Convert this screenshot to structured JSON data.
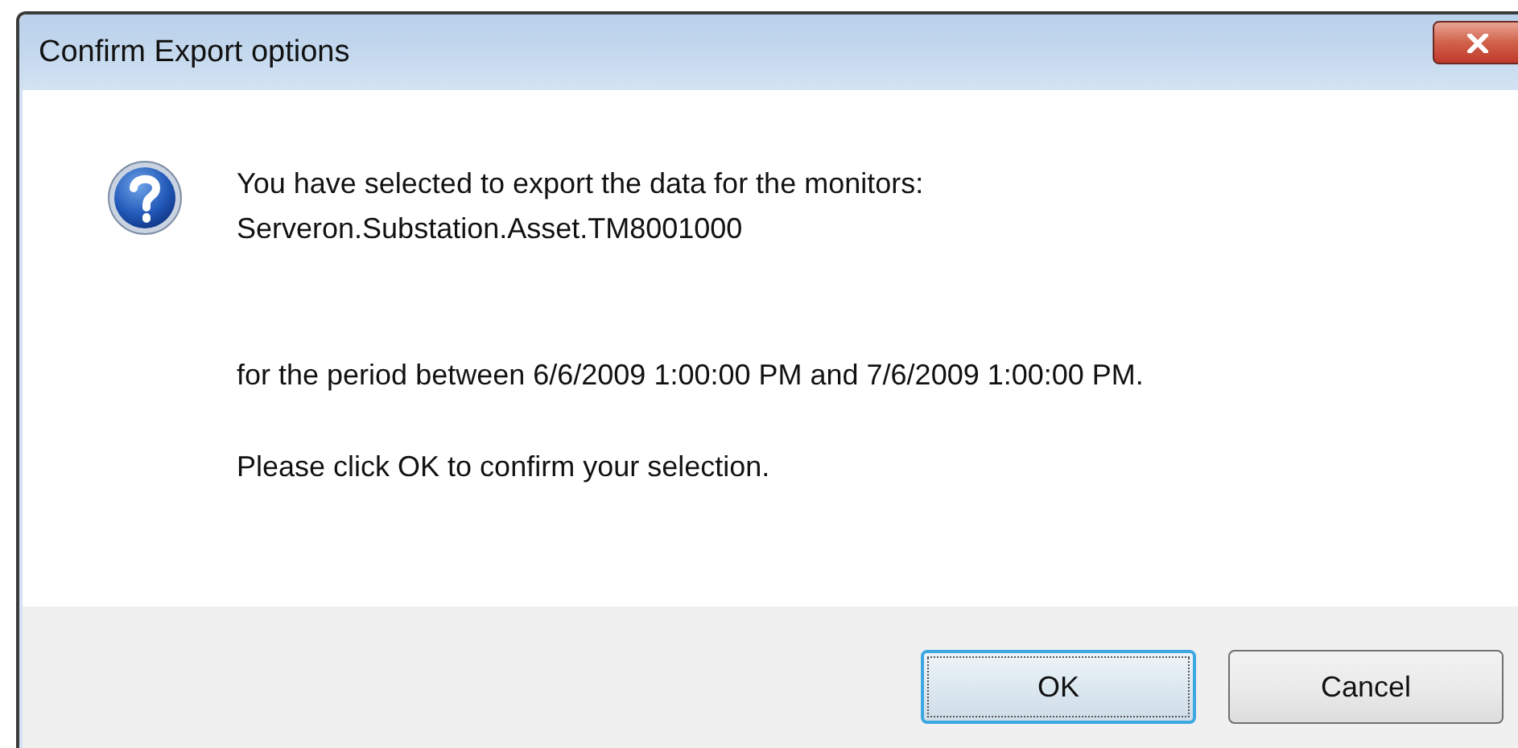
{
  "window": {
    "title": "Confirm Export options"
  },
  "message": {
    "paragraphs": [
      [
        "You have selected to export the data for the monitors:",
        "Serveron.Substation.Asset.TM8001000"
      ],
      [
        "for the period between 6/6/2009 1:00:00 PM and 7/6/2009 1:00:00 PM."
      ],
      [
        "Please click OK to confirm your selection."
      ]
    ]
  },
  "buttons": [
    {
      "label": "OK",
      "default": true
    },
    {
      "label": "Cancel",
      "default": false
    }
  ]
}
